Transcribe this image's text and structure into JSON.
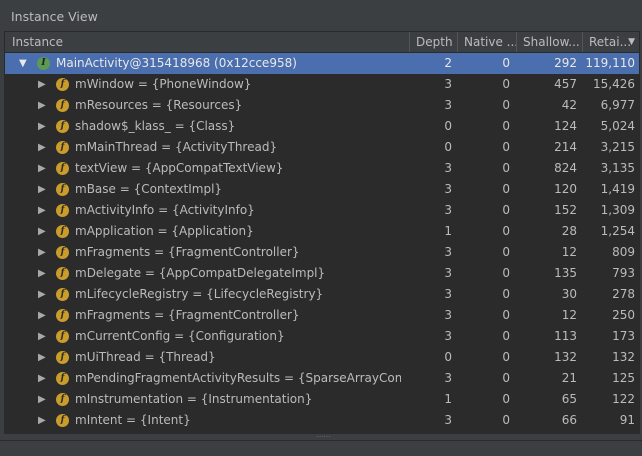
{
  "panel": {
    "title": "Instance View"
  },
  "columns": {
    "instance": "Instance",
    "depth": "Depth",
    "native": "Native ...",
    "shallow": "Shallow...",
    "retained": "Retai..."
  },
  "rows": [
    {
      "name": "MainActivity@315418968 (0x12cce958)",
      "depth": "2",
      "native": "0",
      "shallow": "292",
      "retained": "119,110",
      "expanded": true,
      "badge": "I",
      "selected": true,
      "level": 0
    },
    {
      "name": "mWindow = {PhoneWindow}",
      "depth": "3",
      "native": "0",
      "shallow": "457",
      "retained": "15,426",
      "badge": "f",
      "level": 1
    },
    {
      "name": "mResources = {Resources}",
      "depth": "3",
      "native": "0",
      "shallow": "42",
      "retained": "6,977",
      "badge": "f",
      "level": 1
    },
    {
      "name": "shadow$_klass_ = {Class}",
      "depth": "0",
      "native": "0",
      "shallow": "124",
      "retained": "5,024",
      "badge": "f",
      "level": 1
    },
    {
      "name": "mMainThread = {ActivityThread}",
      "depth": "0",
      "native": "0",
      "shallow": "214",
      "retained": "3,215",
      "badge": "f",
      "level": 1
    },
    {
      "name": "textView = {AppCompatTextView}",
      "depth": "3",
      "native": "0",
      "shallow": "824",
      "retained": "3,135",
      "badge": "f",
      "level": 1
    },
    {
      "name": "mBase = {ContextImpl}",
      "depth": "3",
      "native": "0",
      "shallow": "120",
      "retained": "1,419",
      "badge": "f",
      "level": 1
    },
    {
      "name": "mActivityInfo = {ActivityInfo}",
      "depth": "3",
      "native": "0",
      "shallow": "152",
      "retained": "1,309",
      "badge": "f",
      "level": 1
    },
    {
      "name": "mApplication = {Application}",
      "depth": "1",
      "native": "0",
      "shallow": "28",
      "retained": "1,254",
      "badge": "f",
      "level": 1
    },
    {
      "name": "mFragments = {FragmentController}",
      "depth": "3",
      "native": "0",
      "shallow": "12",
      "retained": "809",
      "badge": "f",
      "level": 1
    },
    {
      "name": "mDelegate = {AppCompatDelegateImpl}",
      "depth": "3",
      "native": "0",
      "shallow": "135",
      "retained": "793",
      "badge": "f",
      "level": 1
    },
    {
      "name": "mLifecycleRegistry = {LifecycleRegistry}",
      "depth": "3",
      "native": "0",
      "shallow": "30",
      "retained": "278",
      "badge": "f",
      "level": 1
    },
    {
      "name": "mFragments = {FragmentController}",
      "depth": "3",
      "native": "0",
      "shallow": "12",
      "retained": "250",
      "badge": "f",
      "level": 1
    },
    {
      "name": "mCurrentConfig = {Configuration}",
      "depth": "3",
      "native": "0",
      "shallow": "113",
      "retained": "173",
      "badge": "f",
      "level": 1
    },
    {
      "name": "mUiThread = {Thread}",
      "depth": "0",
      "native": "0",
      "shallow": "132",
      "retained": "132",
      "badge": "f",
      "level": 1
    },
    {
      "name": "mPendingFragmentActivityResults = {SparseArrayComp",
      "depth": "3",
      "native": "0",
      "shallow": "21",
      "retained": "125",
      "badge": "f",
      "level": 1
    },
    {
      "name": "mInstrumentation = {Instrumentation}",
      "depth": "1",
      "native": "0",
      "shallow": "65",
      "retained": "122",
      "badge": "f",
      "level": 1
    },
    {
      "name": "mIntent = {Intent}",
      "depth": "3",
      "native": "0",
      "shallow": "66",
      "retained": "91",
      "badge": "f",
      "level": 1
    }
  ],
  "colors": {
    "background": "#3c3f41",
    "table_background": "#2b2b2b",
    "selection": "#4b6eaf",
    "field_badge": "#c99c2b",
    "instance_badge": "#5b9a54"
  },
  "icons": {
    "expand": "triangle-right-icon",
    "collapse": "triangle-down-icon",
    "field": "field-badge-icon",
    "instance": "instance-badge-icon",
    "sort": "sort-descending-icon"
  }
}
